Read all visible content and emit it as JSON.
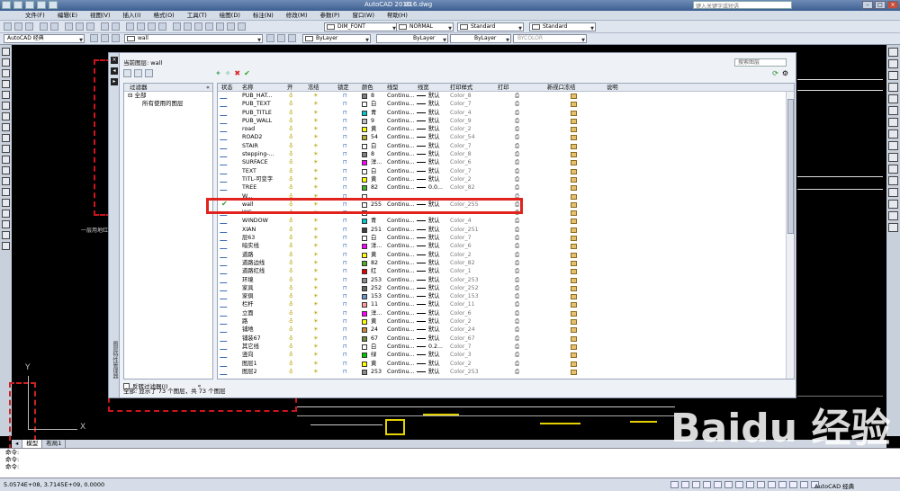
{
  "titlebar": {
    "app_title": "AutoCAD 2010",
    "file_title": "016.dwg",
    "search_placeholder": "键入关键字或短语"
  },
  "menu": [
    "文件(F)",
    "编辑(E)",
    "视图(V)",
    "插入(I)",
    "格式(O)",
    "工具(T)",
    "绘图(D)",
    "标注(N)",
    "修改(M)",
    "参数(P)",
    "窗口(W)",
    "帮助(H)"
  ],
  "toolbar": {
    "text_style": "DIM_FONT",
    "dim_style": "NORMAL",
    "table_style": "Standard",
    "mleader_style": "Standard",
    "workspace": "AutoCAD 经典",
    "layer_current": "wall",
    "color": "ByLayer",
    "linetype": "ByLayer",
    "lineweight": "ByLayer",
    "plotstyle": "BYCOLOR"
  },
  "dialog": {
    "current_layer_label": "当前图层: wall",
    "search_placeholder": "搜索图层",
    "vertical_title": "图层特性管理器",
    "filter_header": "过滤器",
    "filter_tree": [
      "全部",
      "所有使用的图层"
    ],
    "invert_filter": "反转过滤器(I)",
    "status": "全部: 显示了 73 个图层，共 73 个图层",
    "columns": [
      "状态",
      "名称",
      "开",
      "冻结",
      "锁定",
      "颜色",
      "线型",
      "线宽",
      "打印样式",
      "打印",
      "新视口冻结",
      "说明"
    ],
    "rows": [
      {
        "name": "PUB_HAT...",
        "num": "8",
        "color": "#808080",
        "lt": "Continu...",
        "lw": "默认",
        "ps": "Color_8"
      },
      {
        "name": "PUB_TEXT",
        "num": "白",
        "color": "#ffffff",
        "lt": "Continu...",
        "lw": "默认",
        "ps": "Color_7"
      },
      {
        "name": "PUB_TITLE",
        "num": "青",
        "color": "#00c8c8",
        "lt": "Continu...",
        "lw": "默认",
        "ps": "Color_4"
      },
      {
        "name": "PUB_WALL",
        "num": "9",
        "color": "#c0c0c0",
        "lt": "Continu...",
        "lw": "默认",
        "ps": "Color_9"
      },
      {
        "name": "road",
        "num": "黄",
        "color": "#ffff00",
        "lt": "Continu...",
        "lw": "默认",
        "ps": "Color_2"
      },
      {
        "name": "ROAD2",
        "num": "54",
        "color": "#b8b030",
        "lt": "Continu...",
        "lw": "默认",
        "ps": "Color_54"
      },
      {
        "name": "STAIR",
        "num": "白",
        "color": "#ffffff",
        "lt": "Continu...",
        "lw": "默认",
        "ps": "Color_7"
      },
      {
        "name": "stepping-...",
        "num": "8",
        "color": "#808080",
        "lt": "Continu...",
        "lw": "默认",
        "ps": "Color_8"
      },
      {
        "name": "SURFACE",
        "num": "洋...",
        "color": "#ff00ff",
        "lt": "Continu...",
        "lw": "默认",
        "ps": "Color_6"
      },
      {
        "name": "TEXT",
        "num": "白",
        "color": "#ffffff",
        "lt": "Continu...",
        "lw": "默认",
        "ps": "Color_7"
      },
      {
        "name": "TITL-可变字",
        "num": "黄",
        "color": "#ffff00",
        "lt": "Continu...",
        "lw": "默认",
        "ps": "Color_2"
      },
      {
        "name": "TREE",
        "num": "82",
        "color": "#4caf2a",
        "lt": "Continu...",
        "lw": "0.0...",
        "ps": "Color_82"
      },
      {
        "name": "W...",
        "num": "",
        "color": "#ffffff",
        "lt": "",
        "lw": "",
        "ps": "",
        "partial": true
      },
      {
        "name": "wall",
        "num": "255",
        "color": "#ffffff",
        "lt": "Continu...",
        "lw": "默认",
        "ps": "Color_255",
        "current": true
      },
      {
        "name": "WC",
        "num": "",
        "color": "#ffffff",
        "lt": "",
        "lw": "",
        "ps": "",
        "partial": true
      },
      {
        "name": "WINDOW",
        "num": "青",
        "color": "#00c8c8",
        "lt": "Continu...",
        "lw": "默认",
        "ps": "Color_4"
      },
      {
        "name": "XIAN",
        "num": "251",
        "color": "#404040",
        "lt": "Continu...",
        "lw": "默认",
        "ps": "Color_251"
      },
      {
        "name": "层63",
        "num": "白",
        "color": "#ffffff",
        "lt": "Continu...",
        "lw": "默认",
        "ps": "Color_7"
      },
      {
        "name": "暗实线",
        "num": "洋...",
        "color": "#ff00ff",
        "lt": "Continu...",
        "lw": "默认",
        "ps": "Color_6"
      },
      {
        "name": "道路",
        "num": "黄",
        "color": "#ffff00",
        "lt": "Continu...",
        "lw": "默认",
        "ps": "Color_2"
      },
      {
        "name": "道路边线",
        "num": "82",
        "color": "#4caf2a",
        "lt": "Continu...",
        "lw": "默认",
        "ps": "Color_82"
      },
      {
        "name": "道路红线",
        "num": "红",
        "color": "#e00000",
        "lt": "Continu...",
        "lw": "默认",
        "ps": "Color_1"
      },
      {
        "name": "环境",
        "num": "253",
        "color": "#8c8c8c",
        "lt": "Continu...",
        "lw": "默认",
        "ps": "Color_253"
      },
      {
        "name": "家具",
        "num": "252",
        "color": "#666666",
        "lt": "Continu...",
        "lw": "默认",
        "ps": "Color_252"
      },
      {
        "name": "家俱",
        "num": "153",
        "color": "#6a96c8",
        "lt": "Continu...",
        "lw": "默认",
        "ps": "Color_153"
      },
      {
        "name": "栏杆",
        "num": "11",
        "color": "#ff9e9e",
        "lt": "Continu...",
        "lw": "默认",
        "ps": "Color_11"
      },
      {
        "name": "立面",
        "num": "洋...",
        "color": "#ff00ff",
        "lt": "Continu...",
        "lw": "默认",
        "ps": "Color_6"
      },
      {
        "name": "路",
        "num": "黄",
        "color": "#ffff00",
        "lt": "Continu...",
        "lw": "默认",
        "ps": "Color_2"
      },
      {
        "name": "铺地",
        "num": "24",
        "color": "#c88a3a",
        "lt": "Continu...",
        "lw": "默认",
        "ps": "Color_24"
      },
      {
        "name": "铺装67",
        "num": "67",
        "color": "#6a8a3a",
        "lt": "Continu...",
        "lw": "默认",
        "ps": "Color_67"
      },
      {
        "name": "其它线",
        "num": "白",
        "color": "#ffffff",
        "lt": "Continu...",
        "lw": "0.2...",
        "ps": "Color_7"
      },
      {
        "name": "竖向",
        "num": "绿",
        "color": "#00c800",
        "lt": "Continu...",
        "lw": "默认",
        "ps": "Color_3"
      },
      {
        "name": "图层1",
        "num": "黄",
        "color": "#ffff00",
        "lt": "Continu...",
        "lw": "默认",
        "ps": "Color_2"
      },
      {
        "name": "图层2",
        "num": "253",
        "color": "#8c8c8c",
        "lt": "Continu...",
        "lw": "默认",
        "ps": "Color_253"
      }
    ]
  },
  "tabs": [
    "模型",
    "布局1"
  ],
  "command_lines": [
    "命令:",
    "命令:",
    "命令:"
  ],
  "status": {
    "coords": "5.0574E+08, 3.7145E+09, 0.0000",
    "workspace": "AutoCAD 经典"
  },
  "canvas": {
    "ucs_y": "Y",
    "ucs_x": "X",
    "label": "一层用地红线"
  },
  "watermark": {
    "main": "Baidu 经验",
    "sub": "jingyan.baidu.com"
  }
}
